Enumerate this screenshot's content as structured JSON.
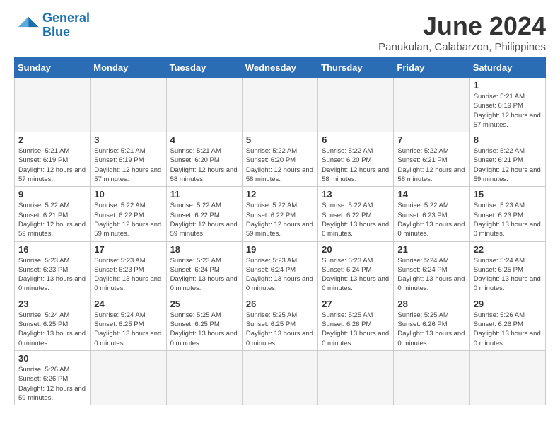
{
  "logo": {
    "line1": "General",
    "line2": "Blue"
  },
  "title": "June 2024",
  "subtitle": "Panukulan, Calabarzon, Philippines",
  "weekdays": [
    "Sunday",
    "Monday",
    "Tuesday",
    "Wednesday",
    "Thursday",
    "Friday",
    "Saturday"
  ],
  "weeks": [
    [
      {
        "day": "",
        "info": ""
      },
      {
        "day": "",
        "info": ""
      },
      {
        "day": "",
        "info": ""
      },
      {
        "day": "",
        "info": ""
      },
      {
        "day": "",
        "info": ""
      },
      {
        "day": "",
        "info": ""
      },
      {
        "day": "1",
        "info": "Sunrise: 5:21 AM\nSunset: 6:19 PM\nDaylight: 12 hours\nand 57 minutes."
      }
    ],
    [
      {
        "day": "2",
        "info": "Sunrise: 5:21 AM\nSunset: 6:19 PM\nDaylight: 12 hours\nand 57 minutes."
      },
      {
        "day": "3",
        "info": "Sunrise: 5:21 AM\nSunset: 6:19 PM\nDaylight: 12 hours\nand 57 minutes."
      },
      {
        "day": "4",
        "info": "Sunrise: 5:21 AM\nSunset: 6:20 PM\nDaylight: 12 hours\nand 58 minutes."
      },
      {
        "day": "5",
        "info": "Sunrise: 5:22 AM\nSunset: 6:20 PM\nDaylight: 12 hours\nand 58 minutes."
      },
      {
        "day": "6",
        "info": "Sunrise: 5:22 AM\nSunset: 6:20 PM\nDaylight: 12 hours\nand 58 minutes."
      },
      {
        "day": "7",
        "info": "Sunrise: 5:22 AM\nSunset: 6:21 PM\nDaylight: 12 hours\nand 58 minutes."
      },
      {
        "day": "8",
        "info": "Sunrise: 5:22 AM\nSunset: 6:21 PM\nDaylight: 12 hours\nand 59 minutes."
      }
    ],
    [
      {
        "day": "9",
        "info": "Sunrise: 5:22 AM\nSunset: 6:21 PM\nDaylight: 12 hours\nand 59 minutes."
      },
      {
        "day": "10",
        "info": "Sunrise: 5:22 AM\nSunset: 6:22 PM\nDaylight: 12 hours\nand 59 minutes."
      },
      {
        "day": "11",
        "info": "Sunrise: 5:22 AM\nSunset: 6:22 PM\nDaylight: 12 hours\nand 59 minutes."
      },
      {
        "day": "12",
        "info": "Sunrise: 5:22 AM\nSunset: 6:22 PM\nDaylight: 12 hours\nand 59 minutes."
      },
      {
        "day": "13",
        "info": "Sunrise: 5:22 AM\nSunset: 6:22 PM\nDaylight: 13 hours\nand 0 minutes."
      },
      {
        "day": "14",
        "info": "Sunrise: 5:22 AM\nSunset: 6:23 PM\nDaylight: 13 hours\nand 0 minutes."
      },
      {
        "day": "15",
        "info": "Sunrise: 5:23 AM\nSunset: 6:23 PM\nDaylight: 13 hours\nand 0 minutes."
      }
    ],
    [
      {
        "day": "16",
        "info": "Sunrise: 5:23 AM\nSunset: 6:23 PM\nDaylight: 13 hours\nand 0 minutes."
      },
      {
        "day": "17",
        "info": "Sunrise: 5:23 AM\nSunset: 6:23 PM\nDaylight: 13 hours\nand 0 minutes."
      },
      {
        "day": "18",
        "info": "Sunrise: 5:23 AM\nSunset: 6:24 PM\nDaylight: 13 hours\nand 0 minutes."
      },
      {
        "day": "19",
        "info": "Sunrise: 5:23 AM\nSunset: 6:24 PM\nDaylight: 13 hours\nand 0 minutes."
      },
      {
        "day": "20",
        "info": "Sunrise: 5:23 AM\nSunset: 6:24 PM\nDaylight: 13 hours\nand 0 minutes."
      },
      {
        "day": "21",
        "info": "Sunrise: 5:24 AM\nSunset: 6:24 PM\nDaylight: 13 hours\nand 0 minutes."
      },
      {
        "day": "22",
        "info": "Sunrise: 5:24 AM\nSunset: 6:25 PM\nDaylight: 13 hours\nand 0 minutes."
      }
    ],
    [
      {
        "day": "23",
        "info": "Sunrise: 5:24 AM\nSunset: 6:25 PM\nDaylight: 13 hours\nand 0 minutes."
      },
      {
        "day": "24",
        "info": "Sunrise: 5:24 AM\nSunset: 6:25 PM\nDaylight: 13 hours\nand 0 minutes."
      },
      {
        "day": "25",
        "info": "Sunrise: 5:25 AM\nSunset: 6:25 PM\nDaylight: 13 hours\nand 0 minutes."
      },
      {
        "day": "26",
        "info": "Sunrise: 5:25 AM\nSunset: 6:25 PM\nDaylight: 13 hours\nand 0 minutes."
      },
      {
        "day": "27",
        "info": "Sunrise: 5:25 AM\nSunset: 6:26 PM\nDaylight: 13 hours\nand 0 minutes."
      },
      {
        "day": "28",
        "info": "Sunrise: 5:25 AM\nSunset: 6:26 PM\nDaylight: 13 hours\nand 0 minutes."
      },
      {
        "day": "29",
        "info": "Sunrise: 5:26 AM\nSunset: 6:26 PM\nDaylight: 13 hours\nand 0 minutes."
      }
    ],
    [
      {
        "day": "30",
        "info": "Sunrise: 5:26 AM\nSunset: 6:26 PM\nDaylight: 12 hours\nand 59 minutes."
      },
      {
        "day": "",
        "info": ""
      },
      {
        "day": "",
        "info": ""
      },
      {
        "day": "",
        "info": ""
      },
      {
        "day": "",
        "info": ""
      },
      {
        "day": "",
        "info": ""
      },
      {
        "day": "",
        "info": ""
      }
    ]
  ]
}
